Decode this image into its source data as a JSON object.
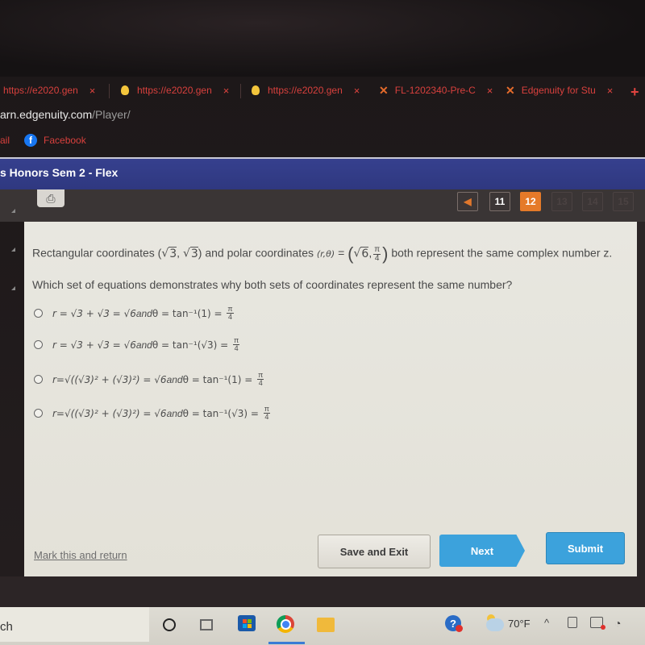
{
  "browser": {
    "tabs": [
      {
        "label": "https://e2020.gen",
        "icon": "none"
      },
      {
        "label": "https://e2020.gen",
        "icon": "lightbulb-icon"
      },
      {
        "label": "https://e2020.gen",
        "icon": "lightbulb-icon"
      },
      {
        "label": "FL-1202340-Pre-C",
        "icon": "edgenuity-x-icon"
      },
      {
        "label": "Edgenuity for Stu",
        "icon": "edgenuity-x-icon"
      }
    ],
    "tab_close": "×",
    "new_tab": "+",
    "url_host": "arn.edgenuity.com",
    "url_path": "/Player/",
    "bookmarks": [
      {
        "label": "ail"
      },
      {
        "label": "Facebook",
        "icon": "facebook-icon"
      }
    ]
  },
  "course": {
    "title": "s Honors Sem 2 - Flex"
  },
  "toolbar": {
    "print_icon": "printer-icon",
    "pager": {
      "prev_glyph": "◀",
      "pages": [
        "11",
        "12",
        "13",
        "14",
        "15"
      ],
      "current": "12"
    }
  },
  "question": {
    "stem_part1": "Rectangular coordinates (",
    "stem_sqrt3a": "3",
    "stem_comma": ", ",
    "stem_sqrt3b": "3",
    "stem_part2": ") and polar coordinates ",
    "stem_polar": "(r,θ)",
    "stem_eq": " = ",
    "stem_sqrt6": "6",
    "stem_pi": "π",
    "stem_four": "4",
    "stem_part3": " both represent the same complex number z.",
    "prompt": "Which set of equations demonstrates why both sets of coordinates represent the same number?"
  },
  "choices": [
    {
      "r_expr": "r = √3 + √3 = √6",
      "and": " and ",
      "theta_expr": "θ = tan⁻¹(1) = ",
      "num": "π",
      "den": "4"
    },
    {
      "r_expr": "r = √3 + √3 = √6",
      "and": " and ",
      "theta_expr": "θ = tan⁻¹(√3) = ",
      "num": "π",
      "den": "4"
    },
    {
      "r_expr": "r=√((√3)² + (√3)²) = √6",
      "and": " and ",
      "theta_expr": "θ = tan⁻¹(1) = ",
      "num": "π",
      "den": "4"
    },
    {
      "r_expr": "r=√((√3)² + (√3)²) = √6",
      "and": " and ",
      "theta_expr": "θ = tan⁻¹(√3) = ",
      "num": "π",
      "den": "4"
    }
  ],
  "actions": {
    "mark_return": "Mark this and return",
    "save_exit": "Save and Exit",
    "next": "Next",
    "submit": "Submit"
  },
  "taskbar": {
    "search_text": "ch",
    "weather_temp": "70°F",
    "tray_chevron": "^"
  },
  "colors": {
    "course_bar": "#36408e",
    "active_page": "#e57a29",
    "primary_button": "#3ca2dc",
    "tab_text": "#d8403d"
  }
}
